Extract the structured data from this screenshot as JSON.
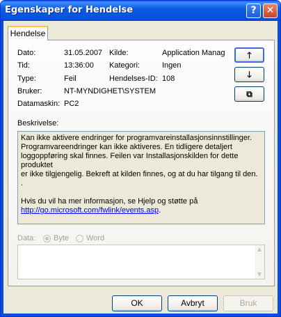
{
  "window": {
    "title": "Egenskaper for Hendelse",
    "help_glyph": "?",
    "close_glyph": "✕"
  },
  "tab": {
    "label": "Hendelse"
  },
  "fields": {
    "date_label": "Dato:",
    "date_value": "31.05.2007",
    "time_label": "Tid:",
    "time_value": "13:36:00",
    "type_label": "Type:",
    "type_value": "Feil",
    "user_label": "Bruker:",
    "user_value": "NT-MYNDIGHET\\SYSTEM",
    "computer_label": "Datamaskin:",
    "computer_value": "PC2",
    "source_label": "Kilde:",
    "source_value": "Application Manag",
    "category_label": "Kategori:",
    "category_value": "Ingen",
    "eventid_label": "Hendelses-ID:",
    "eventid_value": "108"
  },
  "side_buttons": {
    "up": "🡑",
    "down": "🡓",
    "copy": "⧉"
  },
  "description": {
    "label": "Beskrivelse:",
    "line1": "Kan ikke aktivere endringer for programvareinstallasjonsinnstillinger.",
    "line2": "Programvareendringer kan ikke aktiveres. En tidligere detaljert",
    "line3": "loggoppføring skal finnes.  Feilen var Installasjonskilden for dette produktet",
    "line4": "er ikke tilgjengelig. Bekreft at kilden finnes, og at du har tilgang til den. .",
    "help_line": "Hvis du vil ha mer informasjon, se Hjelp og støtte på",
    "link": "http://go.microsoft.com/fwlink/events.asp",
    "link_suffix": "."
  },
  "data_section": {
    "label": "Data:",
    "byte_label": "Byte",
    "word_label": "Word",
    "selected": "Byte"
  },
  "buttons": {
    "ok": "OK",
    "cancel": "Avbryt",
    "apply": "Bruk"
  }
}
